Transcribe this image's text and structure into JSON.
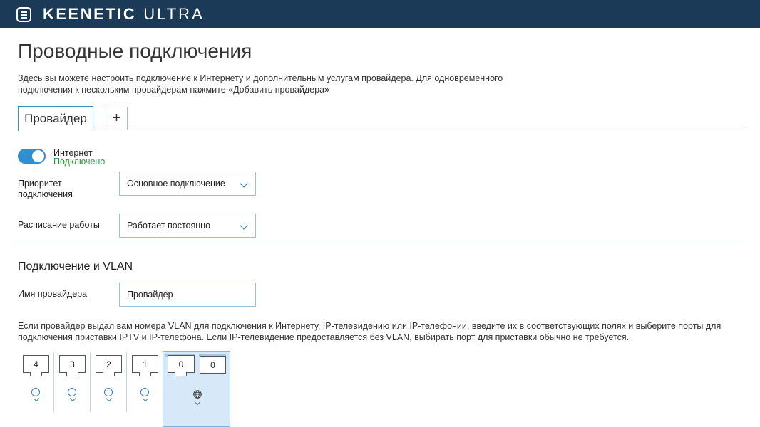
{
  "header": {
    "brand_name": "KEENETIC",
    "brand_model": "ULTRA",
    "menu_icon": "menu-icon",
    "background": "#1a3a57"
  },
  "page": {
    "title": "Проводные подключения",
    "description": "Здесь вы можете настроить подключение к Интернету и дополнительным услугам провайдера. Для одновременного подключения к нескольким провайдерам нажмите «Добавить провайдера»"
  },
  "tabs": [
    {
      "label": "Провайдер",
      "active": true
    },
    {
      "label": "+",
      "active": false
    }
  ],
  "internet": {
    "label": "Интернет",
    "status": "Подключено",
    "enabled": true,
    "status_color": "#1f9e3a",
    "accent": "#2f8fd1"
  },
  "form": {
    "priority_label": "Приоритет подключения",
    "priority_value": "Основное подключение",
    "schedule_label": "Расписание работы",
    "schedule_value": "Работает постоянно"
  },
  "vlan_section": {
    "title": "Подключение и VLAN",
    "provider_name_label": "Имя провайдера",
    "provider_name_value": "Провайдер",
    "description": "Если провайдер выдал вам номера VLAN для подключения к Интернету, IP-телевидению или IP-телефонии, введите их в соответствующих полях и выберите порты для подключения приставки IPTV и IP-телефона. Если IP-телевидение предоставляется без VLAN, выбирать порт для приставки обычно не требуется."
  },
  "ports": [
    {
      "number": "4",
      "selected": false,
      "icon": "radio-icon"
    },
    {
      "number": "3",
      "selected": false,
      "icon": "radio-icon"
    },
    {
      "number": "2",
      "selected": false,
      "icon": "radio-icon"
    },
    {
      "number": "1",
      "selected": false,
      "icon": "radio-icon"
    }
  ],
  "wan_port": {
    "number": "0",
    "sfp_number": "0",
    "selected": true,
    "icon": "globe-icon"
  }
}
